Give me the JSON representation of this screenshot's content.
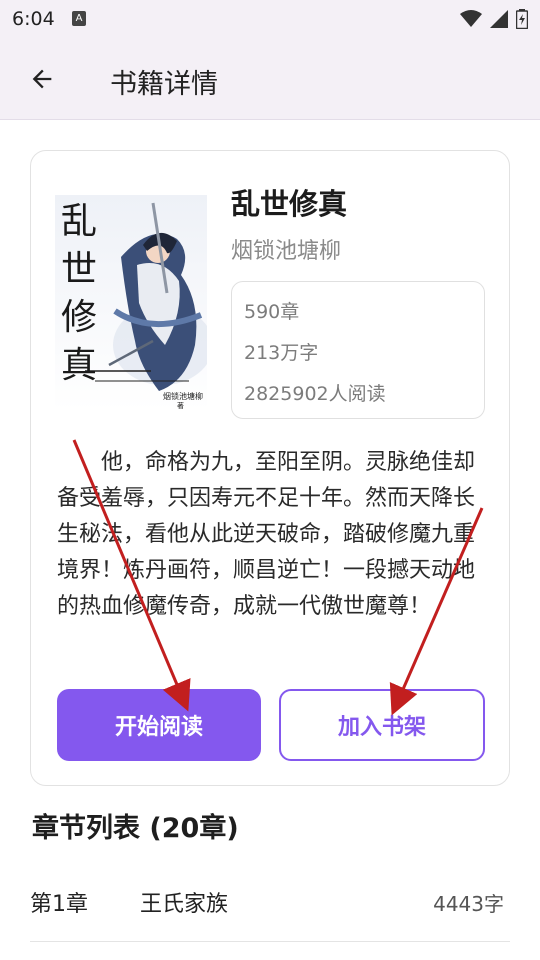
{
  "status_bar": {
    "time": "6:04",
    "notification_icon": "a-letter-icon",
    "icons": [
      "wifi-icon",
      "signal-icon",
      "battery-icon"
    ]
  },
  "app_bar": {
    "back_icon": "arrow-left-icon",
    "title": "书籍详情"
  },
  "book": {
    "title": "乱世修真",
    "author": "烟锁池塘柳",
    "stats": [
      "590章",
      "213万字",
      "2825902人阅读"
    ],
    "description": "他，命格为九，至阳至阴。灵脉绝佳却备受羞辱，只因寿元不足十年。然而天降长生秘法，看他从此逆天破命，踏破修魔九重境界！炼丹画符，顺昌逆亡！一段撼天动地的热血修魔传奇，成就一代傲世魔尊！",
    "cover": {
      "title_chars": [
        "乱",
        "世",
        "修",
        "真"
      ],
      "author_line": "烟锁池塘柳",
      "author_suffix": "著"
    }
  },
  "actions": {
    "start_reading": "开始阅读",
    "add_to_shelf": "加入书架"
  },
  "chapters": {
    "header": "章节列表 (20章)",
    "items": [
      {
        "number": "第1章",
        "name": "王氏家族",
        "words": "4443字"
      }
    ]
  },
  "colors": {
    "accent": "#8458ee",
    "app_bar_bg": "#f4f0f6",
    "annotation_arrow": "#c21f1f"
  }
}
